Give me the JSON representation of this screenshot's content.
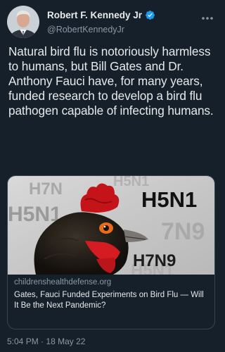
{
  "author": {
    "name": "Robert F. Kennedy Jr",
    "handle": "@RobertKennedyJr",
    "verified": true
  },
  "tweet": {
    "text": "Natural bird flu is notoriously harmless to humans, but Bill Gates and Dr. Anthony Fauci have, for many years, funded research to develop a bird flu pathogen capable of infecting humans.",
    "time": "5:04 PM",
    "separator": "·",
    "date": "18 May 22"
  },
  "link_card": {
    "domain": "childrenshealthdefense.org",
    "title": "Gates, Fauci Funded Experiments on Bird Flu — Will It Be the Next Pandemic?",
    "image_labels": {
      "main": "H5N1",
      "secondary": "H7N9",
      "faded_left": "H5N1",
      "faded_top": "H7N",
      "faded_top_right": "H5N1",
      "faded_right": "7N9",
      "faded_bottom": "H5N1"
    }
  },
  "colors": {
    "background": "#15202b",
    "text": "#e7e9ea",
    "secondary_text": "#8b98a5",
    "verified_badge": "#1d9bf0",
    "card_border": "#38444d"
  },
  "icons": {
    "verified": "verified-badge-icon",
    "more": "more-dots-icon"
  }
}
